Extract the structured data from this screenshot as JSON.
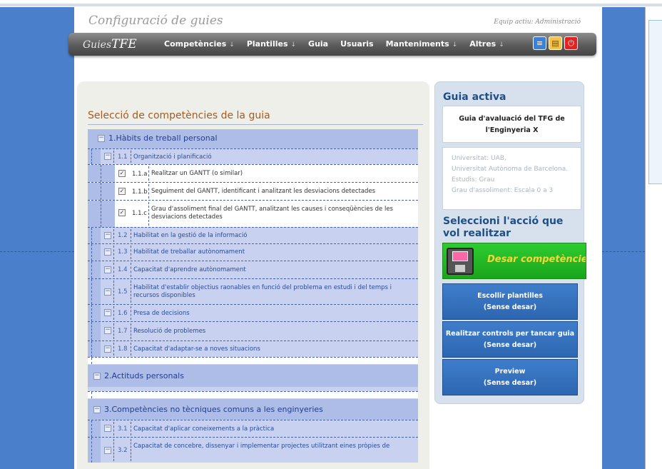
{
  "header": {
    "brand": "Configuració de guies",
    "team": "Equip actiu: Administració"
  },
  "navbar": {
    "logo_prefix": "Guies",
    "logo_suffix": "TFE",
    "menu": [
      {
        "label": "Competències",
        "dropdown": true
      },
      {
        "label": "Plantilles",
        "dropdown": true
      },
      {
        "label": "Guia",
        "dropdown": false
      },
      {
        "label": "Usuaris",
        "dropdown": false
      },
      {
        "label": "Manteniments",
        "dropdown": true
      },
      {
        "label": "Altres",
        "dropdown": true
      }
    ],
    "dropdown_marker": "↓",
    "tools": [
      "document-list-icon",
      "folder-icon",
      "power-icon"
    ]
  },
  "main": {
    "title": "Selecció de competències de la guia",
    "collapse_glyph": "−",
    "check_glyph": "✓",
    "sections": [
      {
        "label": "1.Hàbits de treball personal",
        "subs": [
          {
            "num": "1.1",
            "text": "Organització i planificació",
            "items": [
              {
                "num": "1.1.a",
                "text": "Realitzar un GANTT (o similar)",
                "checked": true
              },
              {
                "num": "1.1.b",
                "text": "Seguiment del GANTT, identificant i analitzant les desviacions detectades",
                "checked": true
              },
              {
                "num": "1.1.c",
                "text": "Grau d'assoliment final del GANTT, analitzant les causes i conseqüències de les desviacions detectades",
                "checked": true
              }
            ]
          },
          {
            "num": "1.2",
            "text": "Habilitat en la gestió de la informació"
          },
          {
            "num": "1.3",
            "text": "Habilitat de treballar autònomament"
          },
          {
            "num": "1.4",
            "text": "Capacitat d'aprendre autònomament"
          },
          {
            "num": "1.5",
            "text": "Habilitat d'establir objectius raonables en funció del problema en estudi i del temps i recursos disponibles"
          },
          {
            "num": "1.6",
            "text": "Presa de decisions"
          },
          {
            "num": "1.7",
            "text": "Resolució de problemes"
          },
          {
            "num": "1.8",
            "text": "Capacitat d'adaptar-se a noves situacions"
          }
        ]
      },
      {
        "label": "2.Actituds personals"
      },
      {
        "label": "3.Competències no tècniques comuns a les enginyeries",
        "subs": [
          {
            "num": "3.1",
            "text": "Capacitat d'aplicar coneixements a la pràctica"
          },
          {
            "num": "3.2",
            "text": "Capacitat de concebre, dissenyar i implementar projectes utilitzant eines pròpies de"
          }
        ]
      }
    ]
  },
  "sidebar": {
    "active_title": "Guia activa",
    "active_guide": "Guia d'avaluació del TFG de l'Enginyeria X",
    "info": [
      "Universitat: UAB,",
      "Universitat Autònoma de Barcelona.",
      "Estudis: Grau",
      "Grau d'assoliment: Escala 0 a 3"
    ],
    "action_title": "Seleccioni l'acció que vol realitzar",
    "save_label": "Desar competències",
    "buttons": [
      {
        "line1": "Escollir plantilles",
        "line2": "(Sense desar)"
      },
      {
        "line1": "Realitzar controls per tancar guia",
        "line2": "(Sense desar)"
      },
      {
        "line1": "Preview",
        "line2": "(Sense desar)"
      }
    ]
  }
}
